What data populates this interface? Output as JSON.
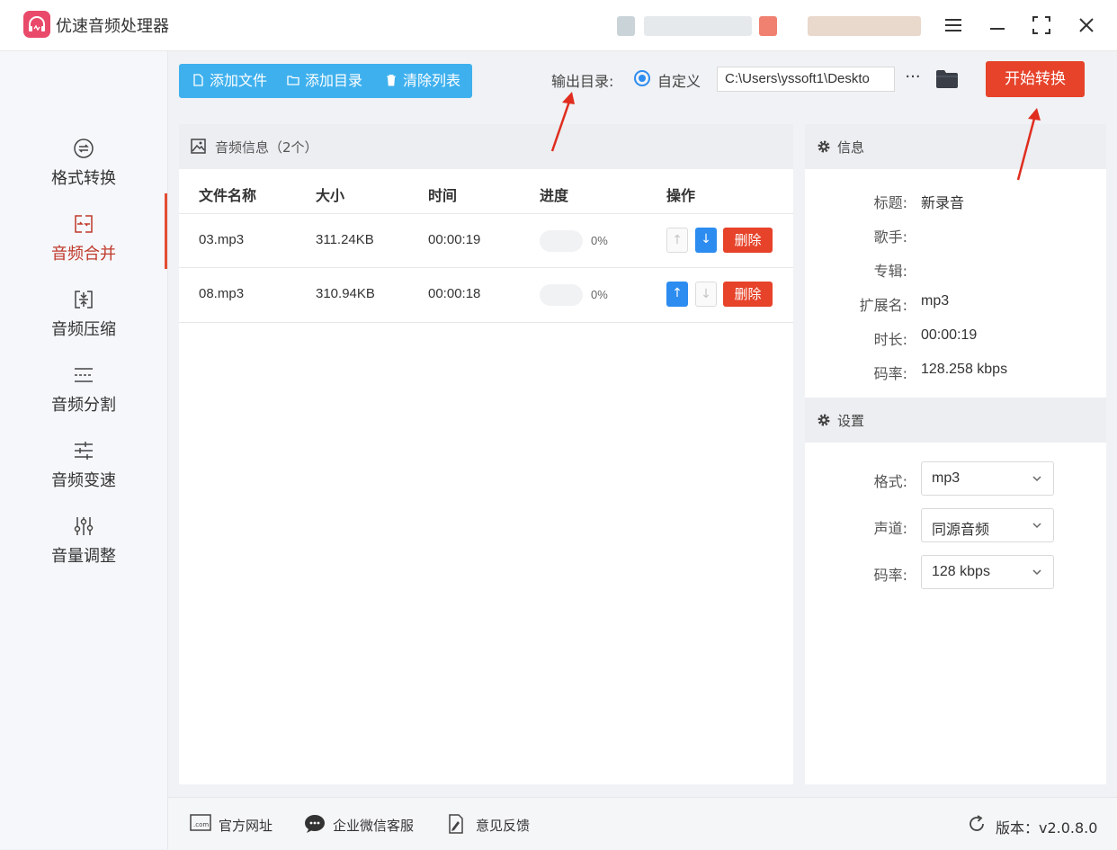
{
  "app": {
    "title": "优速音频处理器"
  },
  "sidebar": {
    "items": [
      {
        "label": "格式转换",
        "active": false,
        "icon": "swap-circle-icon"
      },
      {
        "label": "音频合并",
        "active": true,
        "icon": "merge-icon"
      },
      {
        "label": "音频压缩",
        "active": false,
        "icon": "compress-icon"
      },
      {
        "label": "音频分割",
        "active": false,
        "icon": "split-icon"
      },
      {
        "label": "音频变速",
        "active": false,
        "icon": "speed-sliders-icon"
      },
      {
        "label": "音量调整",
        "active": false,
        "icon": "volume-sliders-icon"
      }
    ]
  },
  "toolbar": {
    "add_file": "添加文件",
    "add_folder": "添加目录",
    "clear_list": "清除列表",
    "output_label": "输出目录:",
    "radio_label": "自定义",
    "output_path": "C:\\Users\\yssoft1\\Deskto",
    "more": "···",
    "start": "开始转换"
  },
  "files": {
    "header": "音频信息（2个）",
    "columns": [
      "文件名称",
      "大小",
      "时间",
      "进度",
      "操作"
    ],
    "rows": [
      {
        "name": "03.mp3",
        "size": "311.24KB",
        "time": "00:00:19",
        "progress": "0%",
        "up_enabled": false,
        "down_enabled": true,
        "delete": "删除"
      },
      {
        "name": "08.mp3",
        "size": "310.94KB",
        "time": "00:00:18",
        "progress": "0%",
        "up_enabled": true,
        "down_enabled": false,
        "delete": "删除"
      }
    ]
  },
  "info": {
    "header": "信息",
    "fields": [
      {
        "label": "标题:",
        "value": "新录音"
      },
      {
        "label": "歌手:",
        "value": ""
      },
      {
        "label": "专辑:",
        "value": ""
      },
      {
        "label": "扩展名:",
        "value": "mp3"
      },
      {
        "label": "时长:",
        "value": "00:00:19"
      },
      {
        "label": "码率:",
        "value": "128.258 kbps"
      }
    ]
  },
  "settings": {
    "header": "设置",
    "fields": [
      {
        "label": "格式:",
        "value": "mp3"
      },
      {
        "label": "声道:",
        "value": "同源音频"
      },
      {
        "label": "码率:",
        "value": "128 kbps"
      }
    ]
  },
  "footer": {
    "website": "官方网址",
    "wechat": "企业微信客服",
    "feedback": "意见反馈",
    "version": "版本：v2.0.8.0"
  },
  "colors": {
    "accent_red": "#e6432a",
    "toolbar_blue": "#3eb0ee",
    "primary_blue": "#2d8cf0",
    "active_nav": "#c0392b"
  }
}
